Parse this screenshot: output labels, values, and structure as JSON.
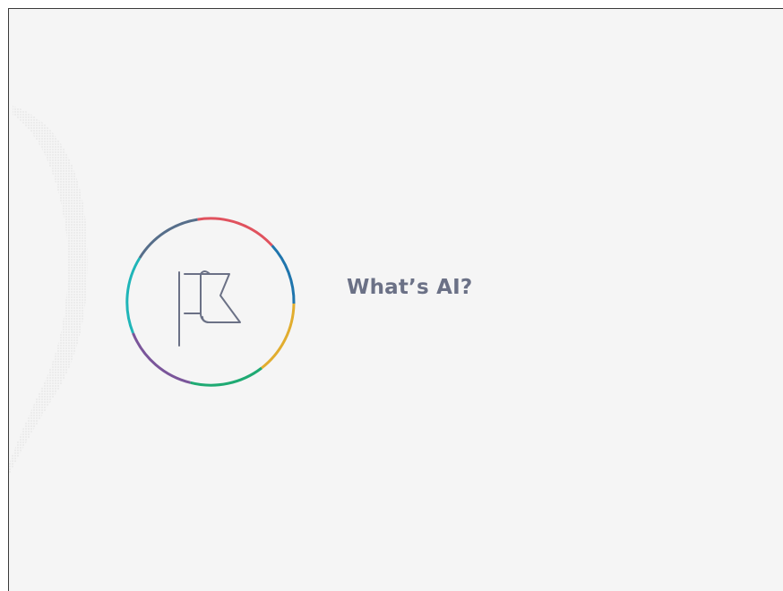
{
  "slide": {
    "title": "What’s AI?",
    "icon": "flag-icon",
    "ring_colors": [
      "#e0525e",
      "#1f75ad",
      "#e1ad2f",
      "#1faa73",
      "#7a559a",
      "#1fb5b8",
      "#566e8a"
    ],
    "icon_color": "#6b7186",
    "background": "#f5f5f5"
  }
}
